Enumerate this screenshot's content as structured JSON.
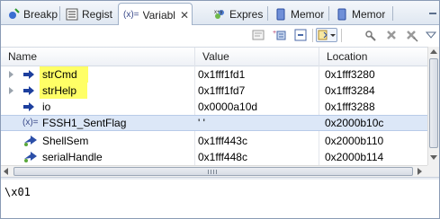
{
  "tabs": [
    {
      "label": "Breakp",
      "icon": "breakpoint-icon",
      "active": false
    },
    {
      "label": "Regist",
      "icon": "registers-icon",
      "active": false
    },
    {
      "label": "Variabl",
      "icon": "variables-icon",
      "icon_text": "(x)=",
      "active": true,
      "close": "✕"
    },
    {
      "label": "Expres",
      "icon": "expressions-icon",
      "active": false
    },
    {
      "label": "Memor",
      "icon": "memory-icon",
      "active": false
    },
    {
      "label": "Memor",
      "icon": "memory-icon",
      "active": false
    }
  ],
  "toolbar": {
    "buttons": [
      "show-type-names-icon",
      "add-global-variables-icon",
      "collapse-all-icon",
      "select-columns-icon",
      "remove-global-icon",
      "remove-all-icon",
      "view-menu-icon"
    ]
  },
  "table": {
    "columns": [
      "Name",
      "Value",
      "Location"
    ],
    "rows": [
      {
        "name": "strCmd",
        "value": "0x1fff1fd1",
        "location": "0x1fff3280",
        "expandable": true,
        "highlighted": true,
        "icon": "pointer-arrow-icon"
      },
      {
        "name": "strHelp",
        "value": "0x1fff1fd7",
        "location": "0x1fff3284",
        "expandable": true,
        "highlighted": true,
        "icon": "pointer-arrow-icon"
      },
      {
        "name": "io",
        "value": "0x0000a10d",
        "location": "0x1fff3288",
        "expandable": false,
        "highlighted": false,
        "icon": "pointer-arrow-icon"
      },
      {
        "name": "FSSH1_SentFlag",
        "value": "' '",
        "location": "0x2000b10c",
        "expandable": false,
        "highlighted": false,
        "selected": true,
        "icon": "global-variable-icon",
        "icon_text": "(x)="
      },
      {
        "name": "ShellSem",
        "value": "0x1fff443c",
        "location": "0x2000b110",
        "expandable": false,
        "highlighted": false,
        "icon": "global-pointer-icon"
      },
      {
        "name": "serialHandle",
        "value": "0x1fff448c",
        "location": "0x2000b114",
        "expandable": false,
        "highlighted": false,
        "icon": "global-pointer-icon"
      }
    ]
  },
  "detail_pane": {
    "text": "\\x01"
  },
  "colors": {
    "highlight": "#ffff66",
    "selected_row": "#dce7f7",
    "arrow_blue": "#1d3f9e"
  }
}
